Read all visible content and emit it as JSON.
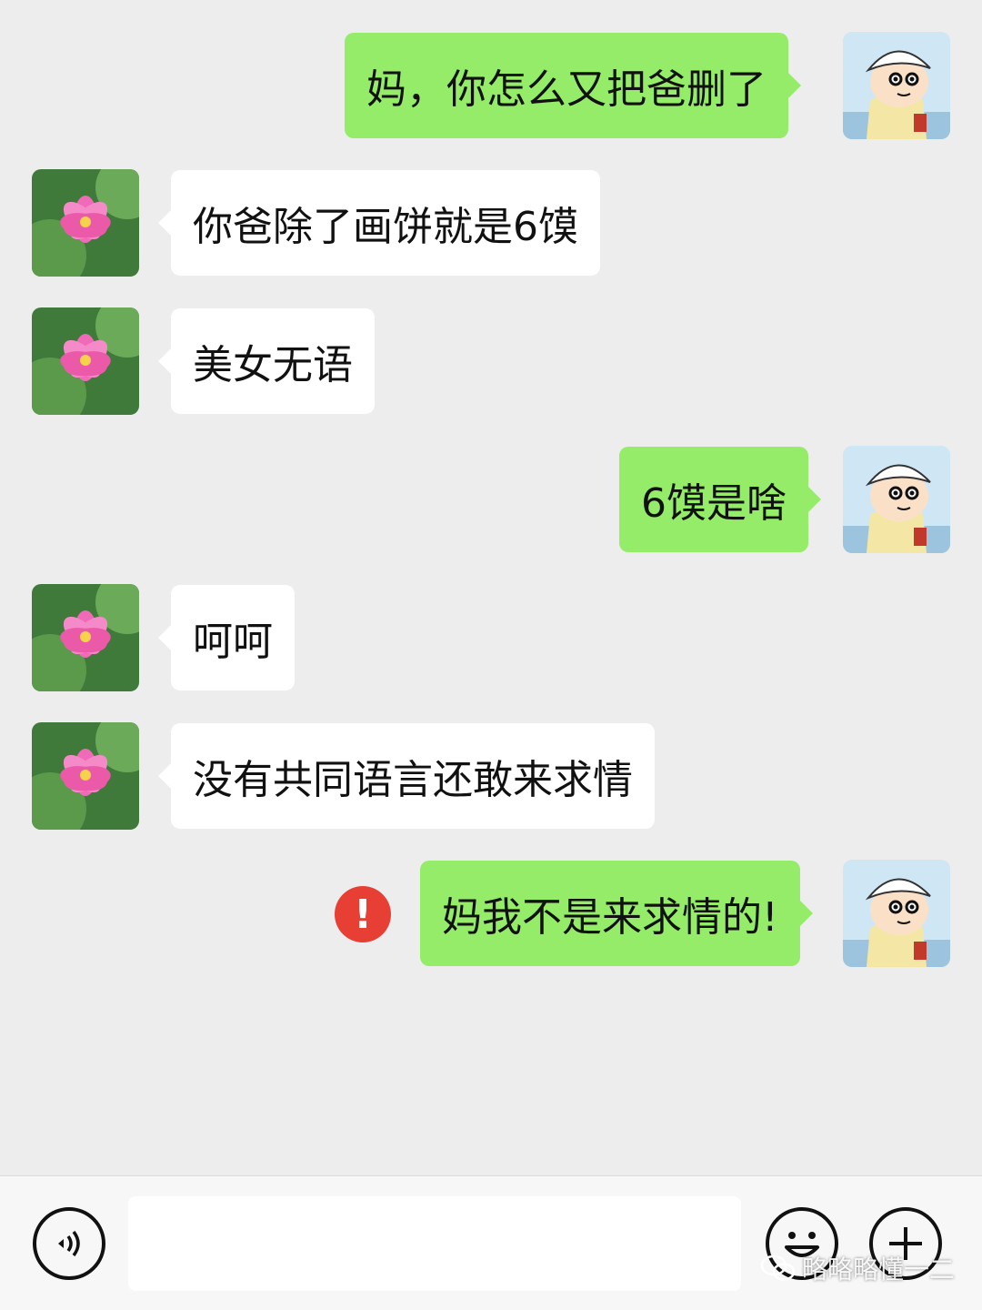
{
  "messages": [
    {
      "side": "right",
      "text": "妈，你怎么又把爸删了"
    },
    {
      "side": "left",
      "text": "你爸除了画饼就是6馍"
    },
    {
      "side": "left",
      "text": "美女无语"
    },
    {
      "side": "right",
      "text": "6馍是啥"
    },
    {
      "side": "left",
      "text": "呵呵"
    },
    {
      "side": "left",
      "text": "没有共同语言还敢来求情"
    },
    {
      "side": "right",
      "text": "妈我不是来求情的!",
      "status": "failed"
    }
  ],
  "contact_avatar": {
    "caption": "花开富贵",
    "icon": "lotus-flower-icon"
  },
  "self_avatar": {
    "icon": "cartoon-boy-icon"
  },
  "error_icon": {
    "symbol": "!",
    "color": "#e83f35"
  },
  "input_bar": {
    "voice_icon": "voice-icon",
    "emoji_icon": "emoji-icon",
    "plus_icon": "plus-icon",
    "text_value": ""
  },
  "watermark": {
    "text": "略略略懂一二",
    "icon": "wechat-icon"
  },
  "colors": {
    "sent_bubble": "#95ec69",
    "received_bubble": "#ffffff",
    "background": "#ededed"
  }
}
